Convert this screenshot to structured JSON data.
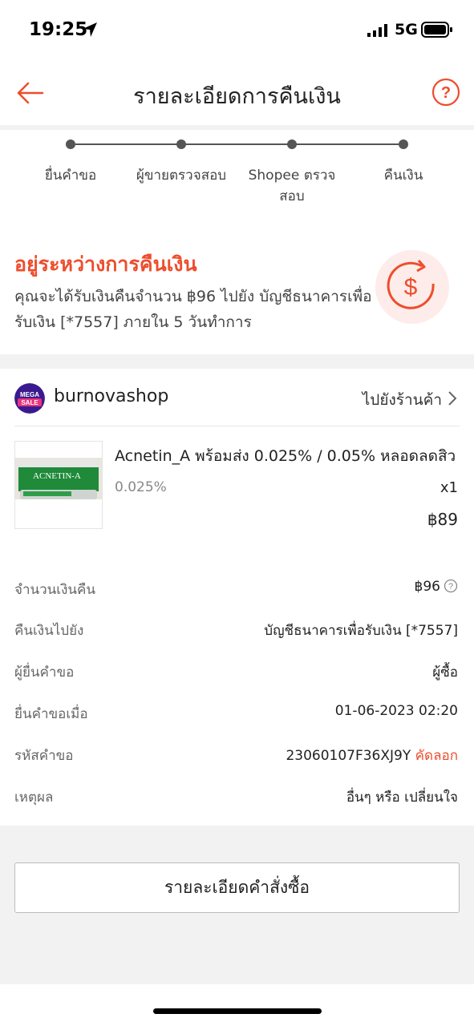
{
  "status_bar": {
    "time": "19:25",
    "network": "5G"
  },
  "header": {
    "title": "รายละเอียดการคืนเงิน"
  },
  "progress": {
    "steps": [
      "ยื่นคำขอ",
      "ผู้ขายตรวจสอบ",
      "Shopee ตรวจสอบ",
      "คืนเงิน"
    ]
  },
  "refund": {
    "status": "อยู่ระหว่างการคืนเงิน",
    "description": "คุณจะได้รับเงินคืนจำนวน ฿96 ไปยัง บัญชีธนาคารเพื่อรับเงิน [*7557] ภายใน 5 วันทำการ"
  },
  "shop": {
    "logo_text_1": "MEGA",
    "logo_text_2": "SALE",
    "name": "burnovashop",
    "link_label": "ไปยังร้านค้า"
  },
  "product": {
    "name": "Acnetin_A พร้อมส่ง 0.025% / 0.05% หลอดลดสิว",
    "variant": "0.025%",
    "quantity": "x1",
    "price": "฿89",
    "thumb_text": "ACNETIN-A"
  },
  "details": [
    {
      "label": "จำนวนเงินคืน",
      "value": "฿96"
    },
    {
      "label": "คืนเงินไปยัง",
      "value": "บัญชีธนาคารเพื่อรับเงิน [*7557]"
    },
    {
      "label": "ผู้ยื่นคำขอ",
      "value": "ผู้ซื้อ"
    },
    {
      "label": "ยื่นคำขอเมื่อ",
      "value": "01-06-2023 02:20"
    },
    {
      "label": "รหัสคำขอ",
      "value": "23060107F36XJ9Y",
      "action": "คัดลอก"
    },
    {
      "label": "เหตุผล",
      "value": "อื่นๆ หรือ เปลี่ยนใจ"
    }
  ],
  "order_button": "รายละเอียดคำสั่งซื้อ",
  "colors": {
    "accent": "#ee4d2d",
    "background": "#f2f2f2"
  }
}
